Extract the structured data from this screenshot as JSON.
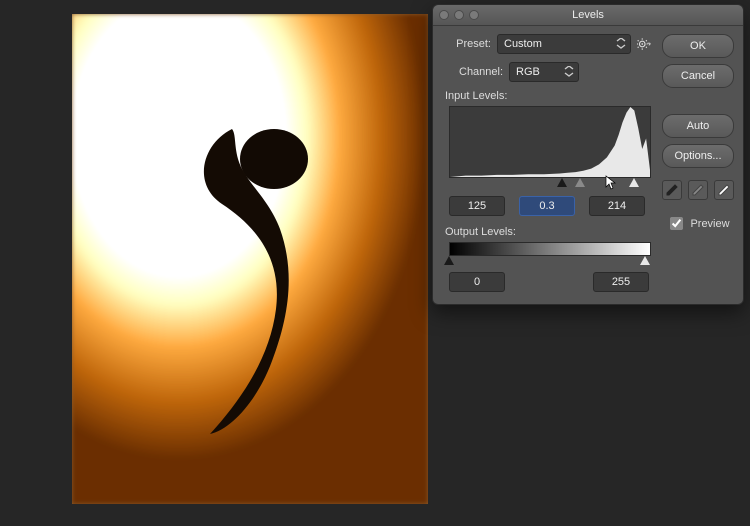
{
  "dialog": {
    "title": "Levels",
    "preset_label": "Preset:",
    "preset_value": "Custom",
    "channel_label": "Channel:",
    "channel_value": "RGB",
    "input_levels_label": "Input Levels:",
    "output_levels_label": "Output Levels:",
    "input_black": "125",
    "input_gamma": "0.3",
    "input_white": "214",
    "output_black": "0",
    "output_white": "255",
    "preview_label": "Preview"
  },
  "buttons": {
    "ok": "OK",
    "cancel": "Cancel",
    "auto": "Auto",
    "options": "Options..."
  },
  "icons": {
    "gear": "gear-icon",
    "chevron": "chevron-down-icon",
    "eyedropper_black": "eyedropper-black-icon",
    "eyedropper_gray": "eyedropper-gray-icon",
    "eyedropper_white": "eyedropper-white-icon"
  },
  "chart_data": {
    "type": "area",
    "title": "",
    "xlabel": "",
    "ylabel": "",
    "xlim": [
      0,
      255
    ],
    "ylim": [
      0,
      1
    ],
    "series": [
      {
        "name": "histogram",
        "x": [
          0,
          20,
          40,
          60,
          80,
          100,
          120,
          140,
          150,
          160,
          170,
          180,
          190,
          200,
          210,
          215,
          220,
          225,
          230,
          235,
          240,
          245,
          250,
          255
        ],
        "values": [
          0,
          0.02,
          0.02,
          0.03,
          0.03,
          0.04,
          0.04,
          0.05,
          0.06,
          0.07,
          0.09,
          0.12,
          0.18,
          0.28,
          0.45,
          0.6,
          0.78,
          0.92,
          1.0,
          0.95,
          0.7,
          0.4,
          0.55,
          0.1
        ]
      }
    ]
  }
}
